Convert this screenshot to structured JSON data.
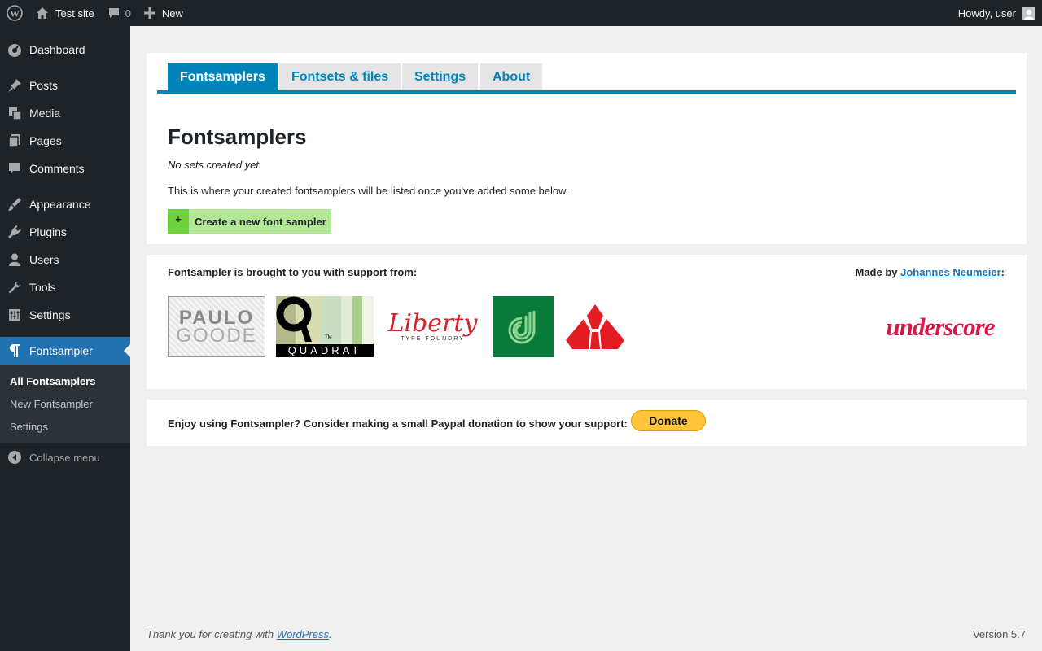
{
  "adminbar": {
    "site_name": "Test site",
    "comments_count": "0",
    "new_label": "New",
    "greeting": "Howdy, user"
  },
  "sidebar": {
    "items": [
      {
        "label": "Dashboard",
        "icon": "dashboard-icon"
      },
      {
        "label": "Posts",
        "icon": "pin-icon"
      },
      {
        "label": "Media",
        "icon": "media-icon"
      },
      {
        "label": "Pages",
        "icon": "pages-icon"
      },
      {
        "label": "Comments",
        "icon": "comments-icon"
      },
      {
        "label": "Appearance",
        "icon": "brush-icon"
      },
      {
        "label": "Plugins",
        "icon": "plugin-icon"
      },
      {
        "label": "Users",
        "icon": "users-icon"
      },
      {
        "label": "Tools",
        "icon": "wrench-icon"
      },
      {
        "label": "Settings",
        "icon": "settings-icon"
      },
      {
        "label": "Fontsampler",
        "icon": "pilcrow-icon"
      }
    ],
    "submenu": [
      "All Fontsamplers",
      "New Fontsampler",
      "Settings"
    ],
    "collapse_label": "Collapse menu"
  },
  "tabs": [
    "Fontsamplers",
    "Fontsets & files",
    "Settings",
    "About"
  ],
  "main": {
    "title": "Fontsamplers",
    "no_sets": "No sets created yet.",
    "description": "This is where your created fontsamplers will be listed once you've added some below.",
    "create_plus": "+",
    "create_label": "Create a new font sampler"
  },
  "support": {
    "text": "Fontsampler is brought to you with support from:",
    "made_by_prefix": "Made by ",
    "author": "Johannes Neumeier",
    "made_by_suffix": ":",
    "logos": {
      "paulo_top": "PAULO",
      "paulo_bottom": "GOODE",
      "quadrat": "QUADRAT",
      "quadrat_tm": "TM",
      "liberty": "Liberty",
      "liberty_sub": "TYPE FOUNDRY",
      "underscore": "underscore"
    }
  },
  "donate": {
    "text": "Enjoy using Fontsampler? Consider making a small Paypal donation to show your support:",
    "button": "Donate"
  },
  "footer": {
    "thanks_prefix": "Thank you for creating with ",
    "wordpress": "WordPress",
    "thanks_suffix": ".",
    "version": "Version 5.7"
  },
  "colors": {
    "accent": "#0085ba",
    "sidebar_bg": "#1d2327",
    "current_menu": "#2271b1",
    "create_btn": "#b2e895",
    "donate_btn": "#ffc439"
  }
}
